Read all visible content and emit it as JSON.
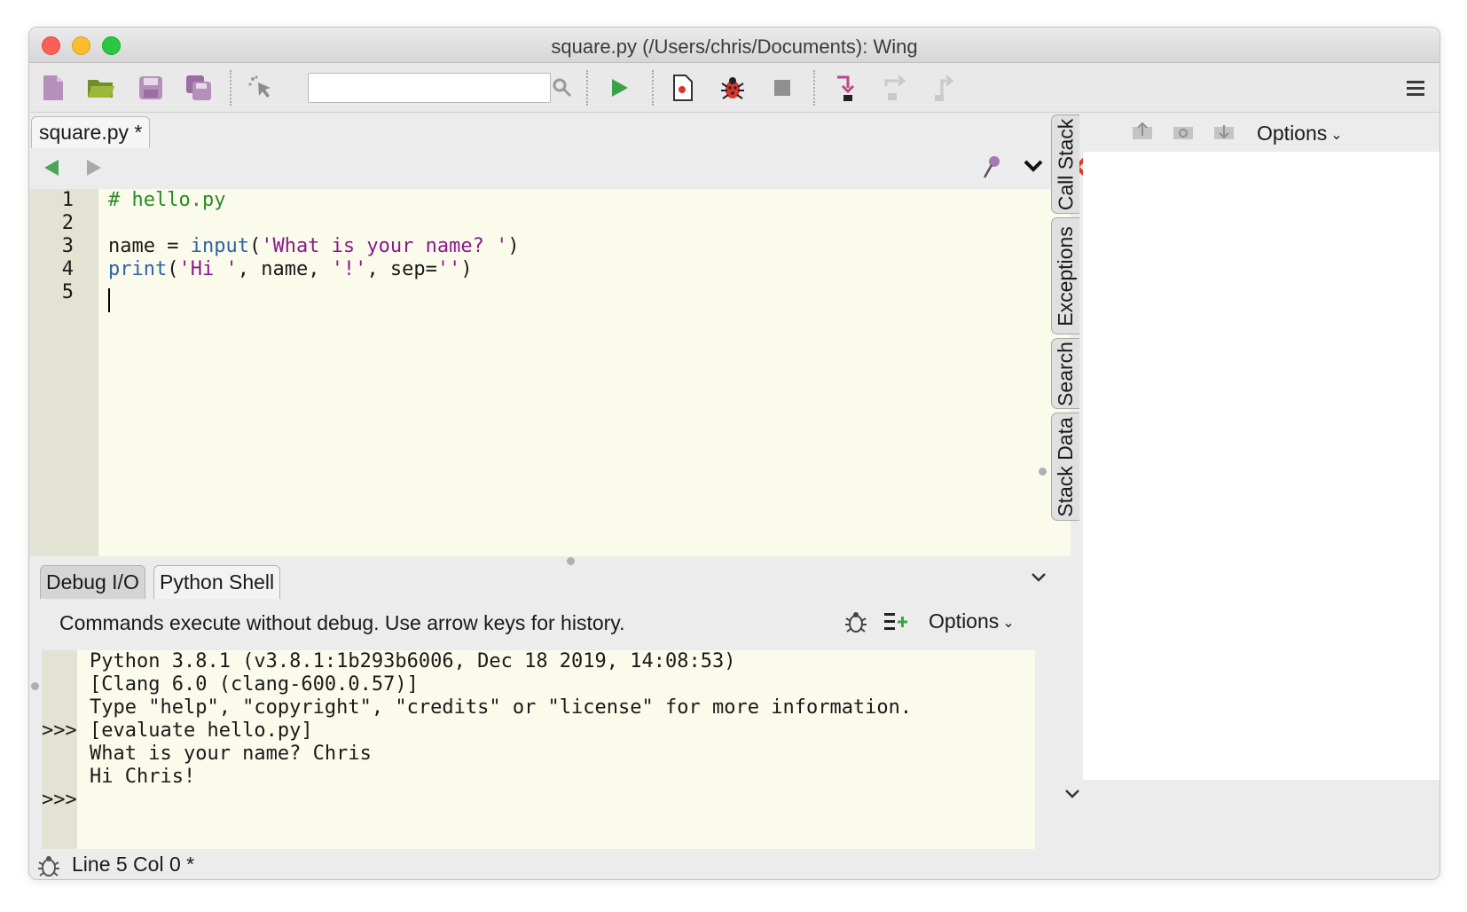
{
  "window": {
    "title": "square.py (/Users/chris/Documents): Wing"
  },
  "toolbar": {
    "search_value": "",
    "icons": [
      "new-file-icon",
      "open-folder-icon",
      "save-icon",
      "save-all-icon",
      "select-pointer-icon",
      "search-icon",
      "run-icon",
      "debug-file-icon",
      "bug-icon",
      "stop-icon",
      "step-into-icon",
      "step-over-icon",
      "step-out-icon",
      "menu-icon"
    ]
  },
  "editor": {
    "tab_label": "square.py *",
    "line_numbers": [
      "1",
      "2",
      "3",
      "4",
      "5"
    ],
    "code": {
      "line1_comment": "# hello.py",
      "line3_a": "name = ",
      "line3_builtin": "input",
      "line3_b": "(",
      "line3_string": "'What is your name? '",
      "line3_c": ")",
      "line4_builtin": "print",
      "line4_a": "(",
      "line4_s1": "'Hi '",
      "line4_b": ", name, ",
      "line4_s2": "'!'",
      "line4_c": ", sep=",
      "line4_s3": "''",
      "line4_d": ")"
    }
  },
  "bottom_panel": {
    "tabs": [
      "Debug I/O",
      "Python Shell"
    ],
    "active_tab": "Python Shell",
    "info": "Commands execute without debug.  Use arrow keys for history.",
    "options_label": "Options",
    "shell_lines": [
      "Python 3.8.1 (v3.8.1:1b293b6006, Dec 18 2019, 14:08:53)",
      "[Clang 6.0 (clang-600.0.57)]",
      "Type \"help\", \"copyright\", \"credits\" or \"license\" for more information.",
      "[evaluate hello.py]",
      "What is your name? Chris",
      "Hi Chris!"
    ],
    "prompt": ">>>"
  },
  "side_tabs": [
    "Call Stack",
    "Exceptions",
    "Search",
    "Stack Data"
  ],
  "right_panel": {
    "options_label": "Options"
  },
  "status": {
    "text": "Line 5 Col 0 *"
  },
  "colors": {
    "editor_bg": "#fbfbeb",
    "gutter_bg": "#e3e3d3",
    "comment": "#2a8a2a",
    "builtin": "#2f62a6",
    "string": "#8b1a8b",
    "close_red": "#e0382c",
    "run_green": "#3aa34a"
  }
}
